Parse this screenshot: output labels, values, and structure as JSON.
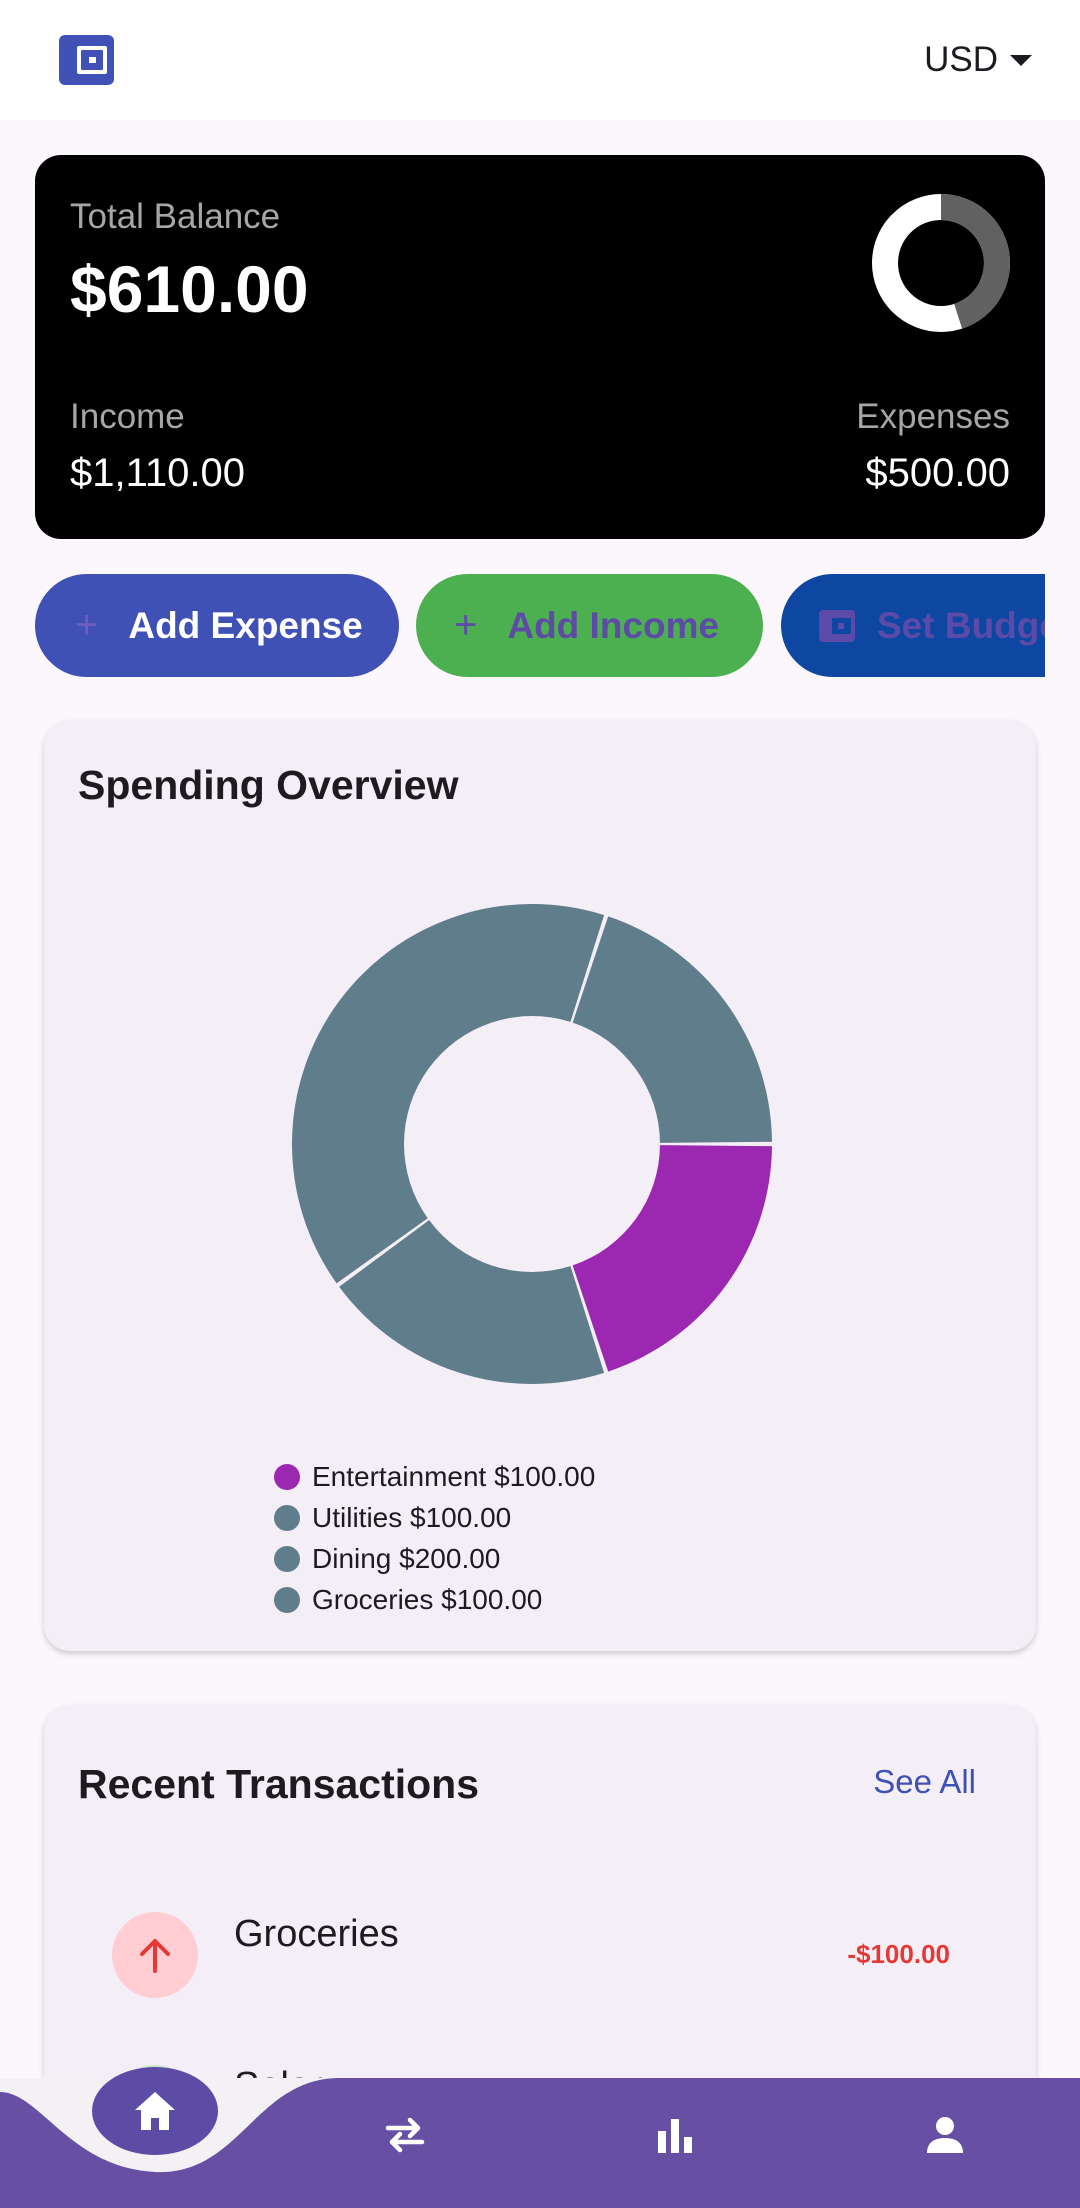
{
  "header": {
    "logo_icon": "wallet-icon",
    "currency": "USD"
  },
  "balance": {
    "label": "Total Balance",
    "value": "$610.00",
    "income_label": "Income",
    "income_value": "$1,110.00",
    "expenses_label": "Expenses",
    "expenses_value": "$500.00",
    "ring_expense_fraction": 0.45
  },
  "actions": [
    {
      "label": "Add Expense",
      "icon": "plus-icon",
      "color": "#3f51b5"
    },
    {
      "label": "Add Income",
      "icon": "plus-icon",
      "color": "#4caf50"
    },
    {
      "label": "Set Budget",
      "icon": "wallet-icon",
      "color": "#0d47a1"
    }
  ],
  "overview": {
    "title": "Spending Overview",
    "legend": [
      {
        "label": "Entertainment $100.00",
        "color": "#9c27b0"
      },
      {
        "label": "Utilities $100.00",
        "color": "#607d8b"
      },
      {
        "label": "Dining $200.00",
        "color": "#607d8b"
      },
      {
        "label": "Groceries $100.00",
        "color": "#607d8b"
      }
    ]
  },
  "chart_data": {
    "type": "pie",
    "categories": [
      "Entertainment",
      "Utilities",
      "Dining",
      "Groceries"
    ],
    "values": [
      100,
      100,
      200,
      100
    ],
    "colors": [
      "#9c27b0",
      "#607d8b",
      "#607d8b",
      "#607d8b"
    ],
    "title": "Spending Overview"
  },
  "transactions": {
    "title": "Recent Transactions",
    "see_all": "See All",
    "items": [
      {
        "name": "Groceries",
        "amount": "-$100.00",
        "icon": "arrow-up-icon"
      },
      {
        "name": "Salary",
        "amount": "",
        "icon": "arrow-down-icon"
      }
    ]
  },
  "nav": {
    "items": [
      "home-icon",
      "swap-icon",
      "bar-chart-icon",
      "person-icon"
    ],
    "active_color": "#5c4ca6",
    "bar_color": "#6750a4"
  }
}
